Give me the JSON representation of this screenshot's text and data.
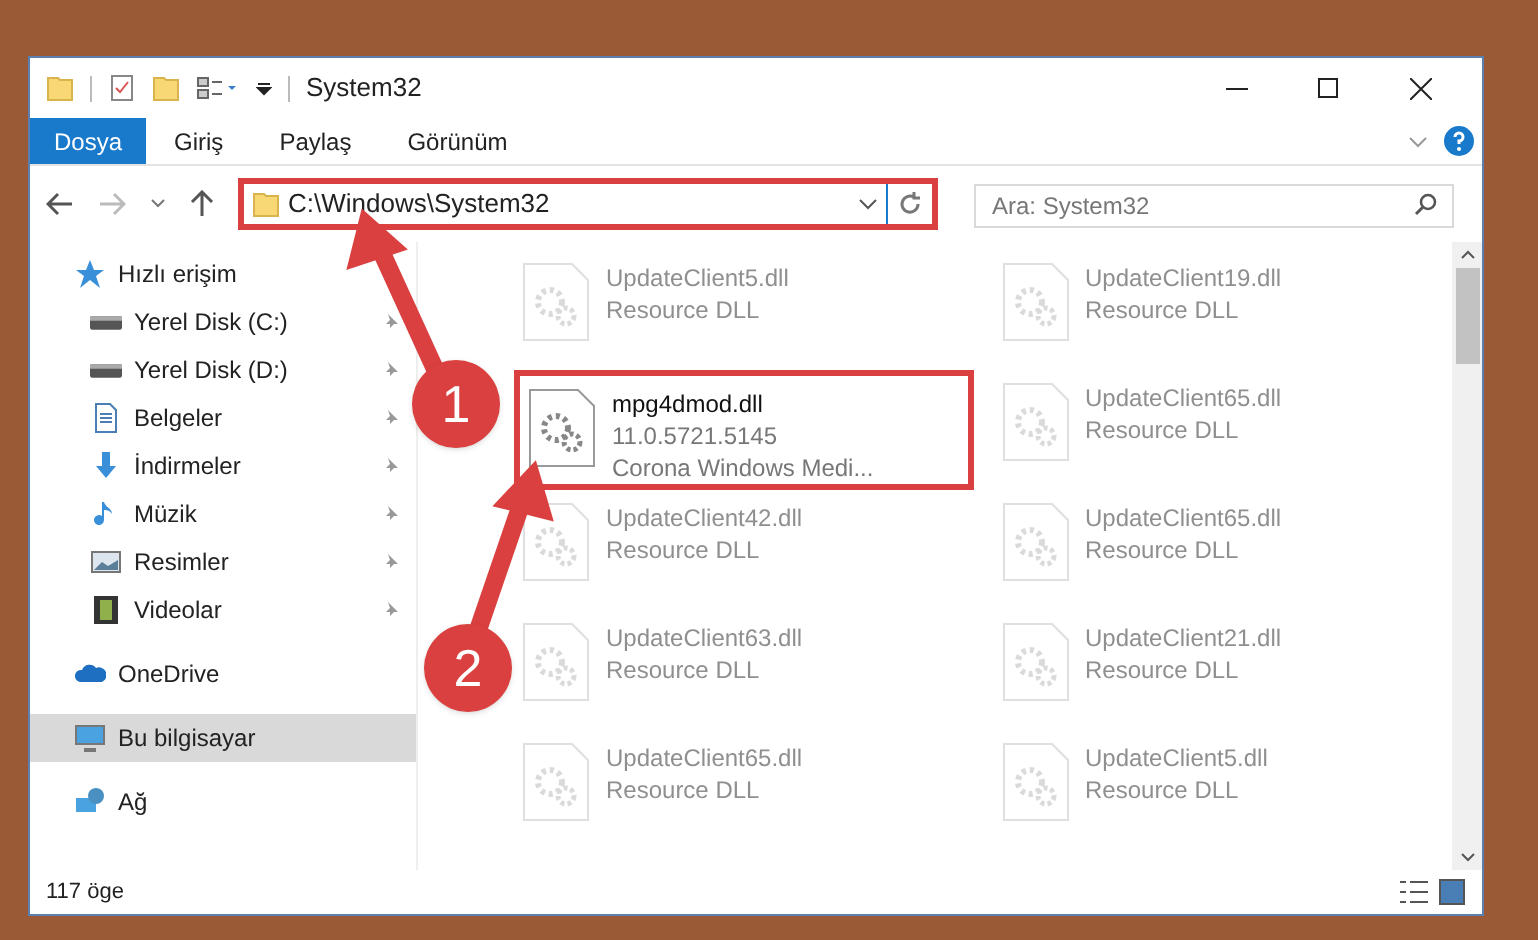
{
  "window": {
    "title": "System32"
  },
  "ribbon_tabs": [
    {
      "label": "Dosya",
      "selected": true
    },
    {
      "label": "Giriş",
      "selected": false
    },
    {
      "label": "Paylaş",
      "selected": false
    },
    {
      "label": "Görünüm",
      "selected": false
    }
  ],
  "address_bar": {
    "path": "C:\\Windows\\System32"
  },
  "search": {
    "placeholder": "Ara: System32"
  },
  "sidebar": {
    "items": [
      {
        "label": "Hızlı erişim",
        "pinned": false,
        "selected": false,
        "children": [
          {
            "label": "Yerel Disk (C:)",
            "pinned": true,
            "selected": false
          },
          {
            "label": "Yerel Disk (D:)",
            "pinned": true,
            "selected": false
          },
          {
            "label": "Belgeler",
            "pinned": true,
            "selected": false
          },
          {
            "label": "İndirmeler",
            "pinned": true,
            "selected": false
          },
          {
            "label": "Müzik",
            "pinned": true,
            "selected": false
          },
          {
            "label": "Resimler",
            "pinned": true,
            "selected": false
          },
          {
            "label": "Videolar",
            "pinned": true,
            "selected": false
          }
        ]
      },
      {
        "label": "OneDrive",
        "pinned": false,
        "selected": false
      },
      {
        "label": "Bu bilgisayar",
        "pinned": false,
        "selected": true
      },
      {
        "label": "Ağ",
        "pinned": false,
        "selected": false
      }
    ]
  },
  "files": [
    {
      "name": "UpdateClient5.dll",
      "details": [
        "Resource DLL"
      ],
      "dimmed": true
    },
    {
      "name": "UpdateClient19.dll",
      "details": [
        "Resource DLL"
      ],
      "dimmed": true
    },
    {
      "name": "mpg4dmod.dll",
      "details": [
        "11.0.5721.5145",
        "Corona Windows Medi..."
      ],
      "dimmed": false
    },
    {
      "name": "UpdateClient65.dll",
      "details": [
        "Resource DLL"
      ],
      "dimmed": true
    },
    {
      "name": "UpdateClient42.dll",
      "details": [
        "Resource DLL"
      ],
      "dimmed": true
    },
    {
      "name": "UpdateClient65.dll",
      "details": [
        "Resource DLL"
      ],
      "dimmed": true
    },
    {
      "name": "UpdateClient63.dll",
      "details": [
        "Resource DLL"
      ],
      "dimmed": true
    },
    {
      "name": "UpdateClient21.dll",
      "details": [
        "Resource DLL"
      ],
      "dimmed": true
    },
    {
      "name": "UpdateClient65.dll",
      "details": [
        "Resource DLL"
      ],
      "dimmed": true
    },
    {
      "name": "UpdateClient5.dll",
      "details": [
        "Resource DLL"
      ],
      "dimmed": true
    }
  ],
  "annotations": [
    {
      "number": "1"
    },
    {
      "number": "2"
    }
  ],
  "status_bar": {
    "count": "117 öge"
  }
}
